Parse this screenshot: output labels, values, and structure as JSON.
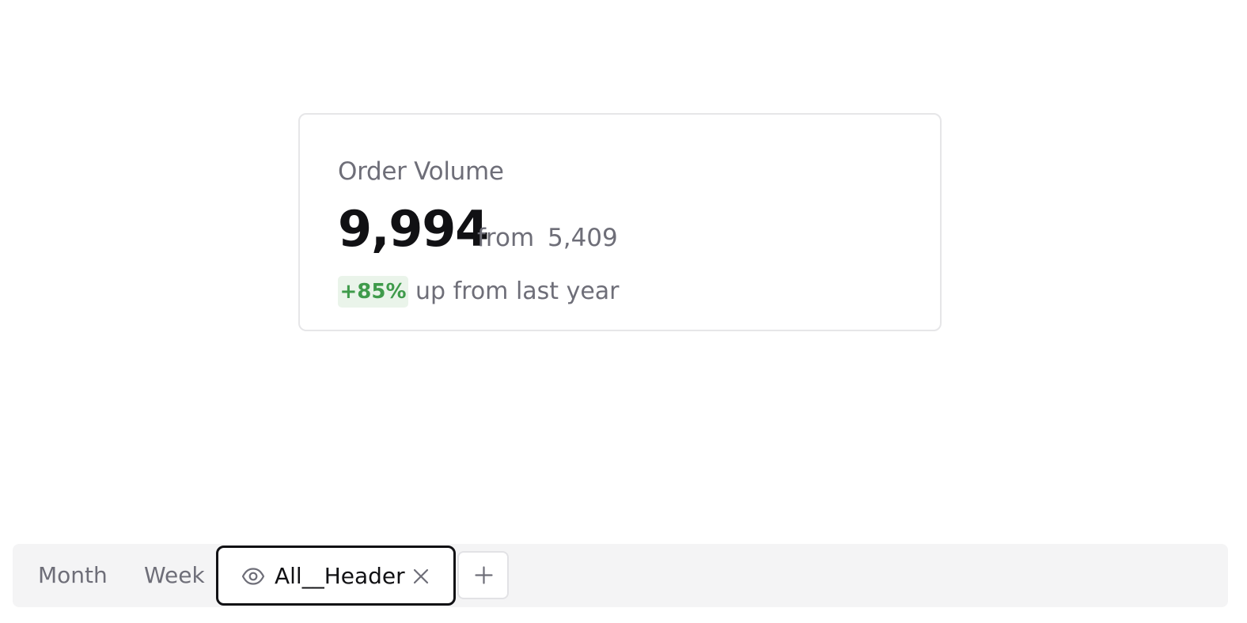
{
  "card": {
    "title": "Order Volume",
    "value": "9,994",
    "from_label": "from",
    "previous_value": "5,409",
    "delta_badge": "+85%",
    "delta_text": "up from last year"
  },
  "tabs": {
    "items": [
      {
        "label": "Month"
      },
      {
        "label": "Week"
      }
    ],
    "active": {
      "label": "All__Header",
      "icon": "eye-icon",
      "close_icon": "close-icon"
    },
    "add_icon": "plus-icon"
  },
  "colors": {
    "delta_positive_text": "#3f9b4b",
    "delta_positive_bg": "#eaf4ea",
    "active_tab_border": "#111114",
    "tabbar_bg": "#f4f4f5"
  }
}
